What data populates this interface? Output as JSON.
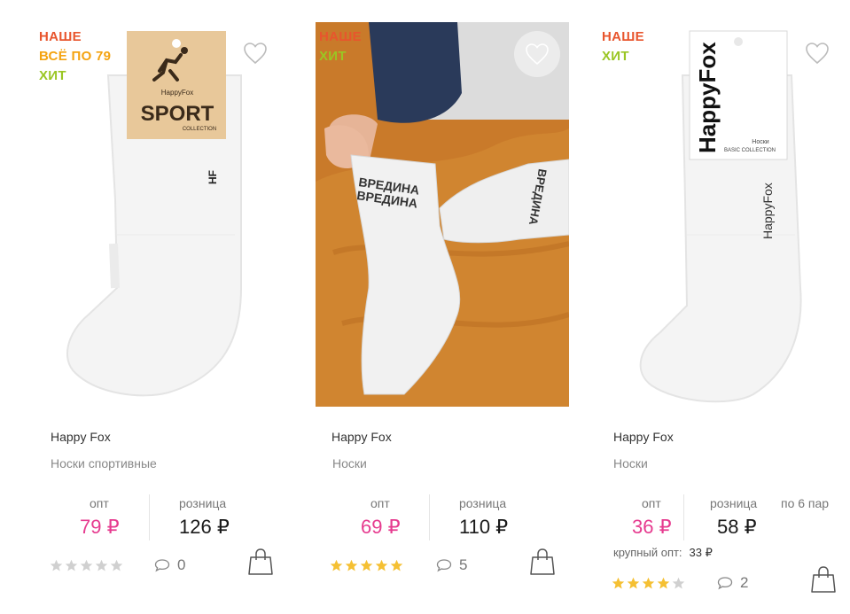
{
  "products": [
    {
      "badges": [
        "НАШЕ",
        "ВСЁ ПО 79",
        "ХИТ"
      ],
      "package_brand": "HappyFox",
      "package_title": "SPORT",
      "package_subtitle": "COLLECTION",
      "brand": "Happy Fox",
      "name": "Носки спортивные",
      "opt_label": "опт",
      "retail_label": "розница",
      "opt_price": "79 ₽",
      "retail_price": "126 ₽",
      "rating": 0,
      "comments": "0"
    },
    {
      "badges": [
        "НАШЕ",
        "ХИТ"
      ],
      "sock_text": "ВРЕДИНА",
      "brand": "Happy Fox",
      "name": "Носки",
      "opt_label": "опт",
      "retail_label": "розница",
      "opt_price": "69 ₽",
      "retail_price": "110 ₽",
      "rating": 5,
      "comments": "5"
    },
    {
      "badges": [
        "НАШЕ",
        "ХИТ"
      ],
      "package_brand": "HappyFox",
      "package_label": "Носки",
      "package_subtitle": "BASIC COLLECTION",
      "sock_brand": "HappyFox",
      "brand": "Happy Fox",
      "name": "Носки",
      "opt_label": "опт",
      "retail_label": "розница",
      "per_pack": "по 6 пар",
      "opt_price": "36 ₽",
      "retail_price": "58 ₽",
      "bulk_label": "крупный опт:",
      "bulk_price": "33 ₽",
      "rating": 4,
      "comments": "2"
    }
  ],
  "colors": {
    "badge_ours": "#e8552d",
    "badge_price": "#f4a310",
    "badge_hit": "#9ac623",
    "opt_price": "#e63b8f",
    "star_filled": "#f5c033",
    "star_empty": "#d0d0d0"
  },
  "icons": {
    "favorite": "heart-outline-icon",
    "comments": "speech-bubble-icon",
    "cart": "shopping-bag-icon",
    "rating": "star-icon"
  }
}
